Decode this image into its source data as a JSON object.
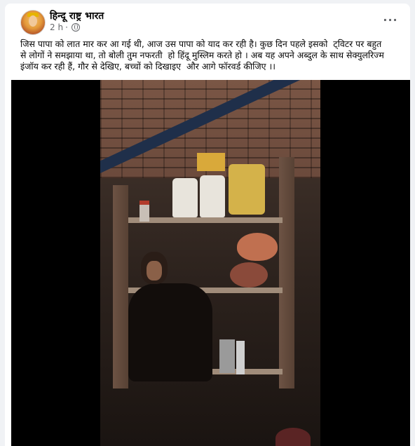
{
  "post": {
    "page_name": "हिन्दू राष्ट्र भारत",
    "time": "2 h",
    "separator": "·",
    "privacy_icon": "globe-icon",
    "more_icon": "more-options-icon",
    "more_label": "···",
    "text": "जिस पापा को लात मार कर आ गई थी, आज उस पापा को याद कर रही है। कुछ दिन पहले इसको  ट्विटर पर बहुत\nसे लोगों ने समझाया था, तो बोली तुम नफरती  हो हिंदू मुस्लिम करते हो । अब यह अपने अब्दुल के साथ सेक्युलरिज्म\nइंजॉय कर रही हैं, गौर से देखिए, बच्चों को दिखाइए  और आगे फॉरवर्ड कीजिए ।।"
  },
  "video": {
    "kind": "video-frame"
  },
  "colors": {
    "page_bg": "#f0f2f5",
    "card_bg": "#ffffff",
    "text_primary": "#050505",
    "text_secondary": "#65676b"
  }
}
